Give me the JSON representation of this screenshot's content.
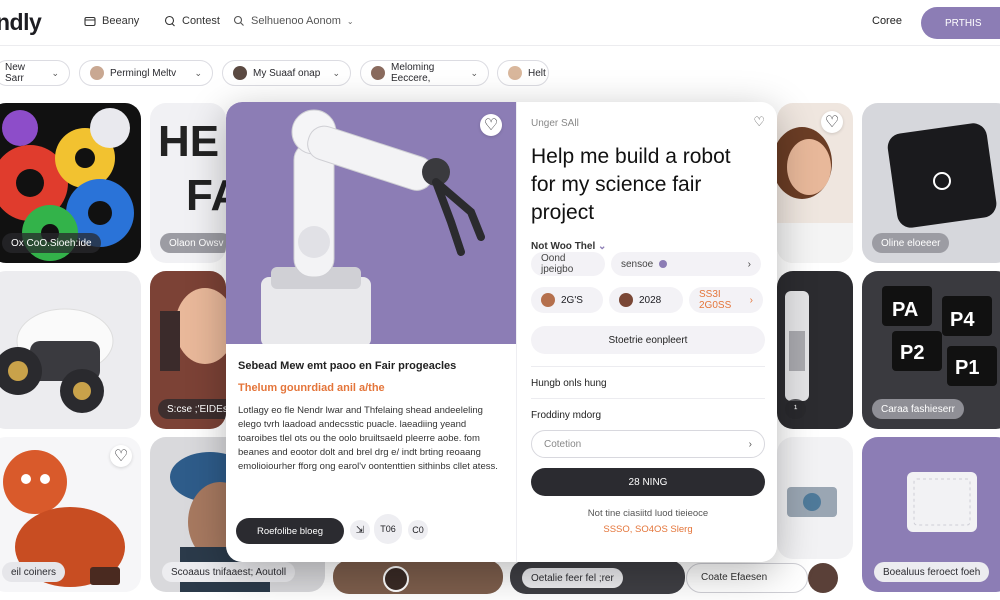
{
  "header": {
    "logo": "ndly",
    "nav": [
      {
        "icon": "folder-icon",
        "label": "Beeany"
      },
      {
        "icon": "chat-icon",
        "label": "Contest"
      },
      {
        "icon": "search-icon",
        "label": "Selhuenoo Aonom"
      }
    ],
    "right_link": "Coree",
    "primary_button": "PRTHIS"
  },
  "filters": [
    {
      "label": "New Sarr",
      "has_avatar": false
    },
    {
      "label": "Permingl Meltv",
      "has_avatar": true
    },
    {
      "label": "My Suaaf onap",
      "has_avatar": true
    },
    {
      "label": "Meloming Eeccere,",
      "has_avatar": true
    },
    {
      "label": "Helt",
      "has_avatar": true
    }
  ],
  "cards": {
    "c1": "Ox CoO.Sioeh:ide",
    "c2": "Olaon Owsv",
    "c2_text": [
      "HE",
      "FA"
    ],
    "c3": "Oline eloeeer",
    "c4": "S:cse ;'EIDEs",
    "c5": "Caraa fashieserr",
    "c6": "eil coiners",
    "c7": "Scoaaus tnifaaest; Aoutoll",
    "c8": "Coate Efaesen",
    "c9": "Boealuus feroect foeh",
    "c10": "Oetalie feer fel ;rer"
  },
  "modal": {
    "left": {
      "title": "Sebead Mew emt paoo en Fair progeacles",
      "subtitle": "Thelum gounrdiad anil a/the",
      "body": "Lotlagy eo fle Nendr lwar and Thfelaing shead andeeleling elego tvrh laadoad andecsstic puacle. laeadiing yeand toaroibes tlel ots ou the oolo bruiltsaeld pleerre aobe. fom beanes and eootor dolt and brel drg e/ indt brting reoaang emolioiourher fforg ong earol'v oontenttien sithinbs cllet atess.",
      "button": "Roefolibe bloeg",
      "mini1": "T06",
      "mini2": "C0"
    },
    "right": {
      "eyebrow": "Unger SAll",
      "title": "Help me build a robot for my science fair project",
      "meta": "Not Woo Thel",
      "pill1": "Oond jpeigbo",
      "pill2": "sensoe",
      "stats": [
        {
          "label": "2G'S"
        },
        {
          "label": "2028"
        },
        {
          "label": "SS3I 2G0SS"
        }
      ],
      "cta": "Stoetrie eonpleert",
      "section1": "Hungb onls hung",
      "section2": "Froddiny mdorg",
      "input_placeholder": "Cotetion",
      "dark_button": "28 NING",
      "footnote1": "Not tine ciasiitd luod tieieoce",
      "footnote2": "SSSO, SO4OS Slerg"
    }
  },
  "colors": {
    "brand": "#8c7db5",
    "accent_orange": "#e4753a",
    "dark": "#2b2b30"
  }
}
